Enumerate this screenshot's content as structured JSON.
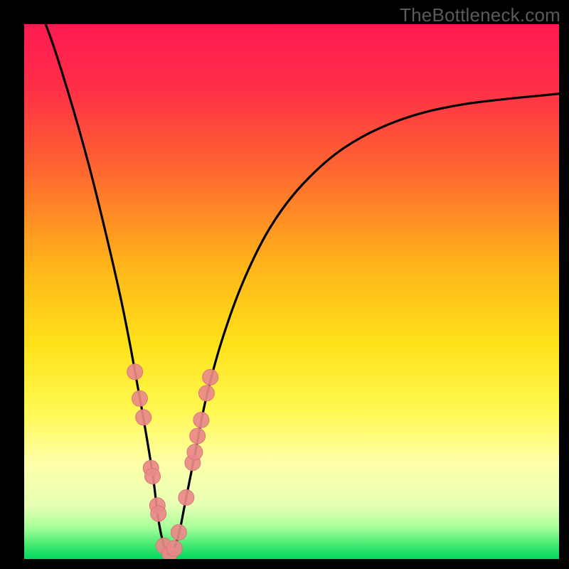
{
  "watermark": "TheBottleneck.com",
  "colors": {
    "frame": "#000000",
    "curve": "#000000",
    "marker_fill": "#e98989",
    "marker_stroke": "#d87878",
    "gradient_stops": [
      {
        "offset": 0.0,
        "color": "#ff1a52"
      },
      {
        "offset": 0.12,
        "color": "#ff2f47"
      },
      {
        "offset": 0.28,
        "color": "#ff6a2f"
      },
      {
        "offset": 0.45,
        "color": "#ffb41a"
      },
      {
        "offset": 0.6,
        "color": "#ffe21a"
      },
      {
        "offset": 0.72,
        "color": "#fff850"
      },
      {
        "offset": 0.82,
        "color": "#ffffa8"
      },
      {
        "offset": 0.9,
        "color": "#e6ffb4"
      },
      {
        "offset": 0.94,
        "color": "#a8ff9a"
      },
      {
        "offset": 0.975,
        "color": "#3fe86f"
      },
      {
        "offset": 1.0,
        "color": "#00d860"
      }
    ]
  },
  "chart_data": {
    "type": "line",
    "title": "",
    "xlabel": "",
    "ylabel": "",
    "xlim": [
      0,
      100
    ],
    "ylim": [
      0,
      100
    ],
    "x_minimum": 27,
    "series": [
      {
        "name": "bottleneck-curve",
        "x": [
          0,
          4,
          8,
          12,
          15,
          18,
          20,
          22,
          24,
          25,
          26,
          27,
          28,
          29,
          30,
          32,
          34,
          37,
          41,
          46,
          52,
          60,
          70,
          82,
          100
        ],
        "values": [
          108,
          100,
          88,
          74,
          62,
          49,
          39,
          28,
          16,
          8,
          3,
          1,
          2,
          5,
          10,
          20,
          30,
          41,
          52,
          62,
          70,
          77,
          82,
          85,
          87
        ]
      }
    ],
    "markers": {
      "name": "highlighted-points",
      "x": [
        20.7,
        21.6,
        22.3,
        23.7,
        24.0,
        24.9,
        25.1,
        26.1,
        27.2,
        28.1,
        28.9,
        30.3,
        31.5,
        31.9,
        32.4,
        33.1,
        34.1,
        34.8
      ],
      "values": [
        35.0,
        30.0,
        26.5,
        17.0,
        15.5,
        10.0,
        8.5,
        2.5,
        1.0,
        2.0,
        5.0,
        11.5,
        18.0,
        20.0,
        23.0,
        26.0,
        31.0,
        34.0
      ]
    }
  }
}
